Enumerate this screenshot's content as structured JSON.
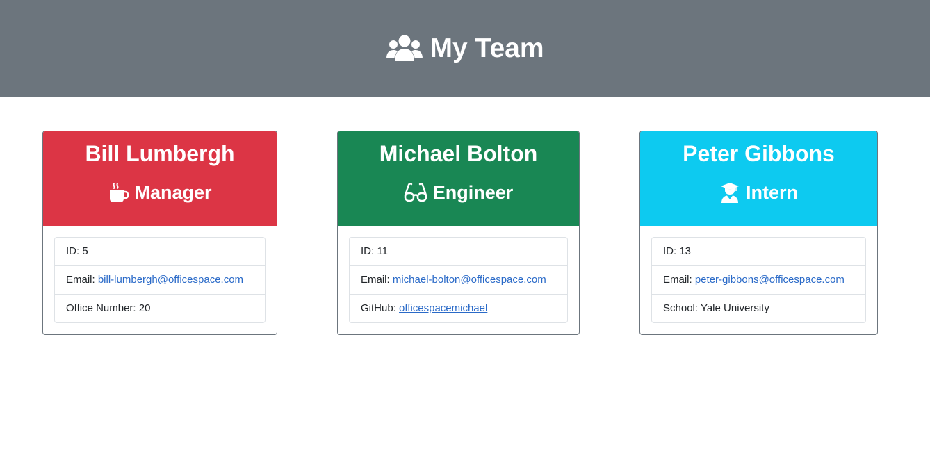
{
  "header": {
    "title": "My Team",
    "icon": "users-icon"
  },
  "colors": {
    "header_bg": "#6c757d",
    "manager": "#dc3545",
    "engineer": "#198754",
    "intern": "#0dcaf0",
    "link": "#2a6ac8"
  },
  "cards": [
    {
      "name": "Bill Lumbergh",
      "role": "Manager",
      "role_icon": "coffee-mug-icon",
      "id_label": "ID: ",
      "id": "5",
      "email_label": "Email: ",
      "email": "bill-lumbergh@officespace.com",
      "extra_label": "Office Number: ",
      "extra": "20"
    },
    {
      "name": "Michael Bolton",
      "role": "Engineer",
      "role_icon": "glasses-icon",
      "id_label": "ID: ",
      "id": "11",
      "email_label": "Email: ",
      "email": "michael-bolton@officespace.com",
      "extra_label": "GitHub: ",
      "extra": "officespacemichael"
    },
    {
      "name": "Peter Gibbons",
      "role": "Intern",
      "role_icon": "graduate-icon",
      "id_label": "ID: ",
      "id": "13",
      "email_label": "Email: ",
      "email": "peter-gibbons@officespace.com",
      "extra_label": "School: ",
      "extra": "Yale University"
    }
  ]
}
